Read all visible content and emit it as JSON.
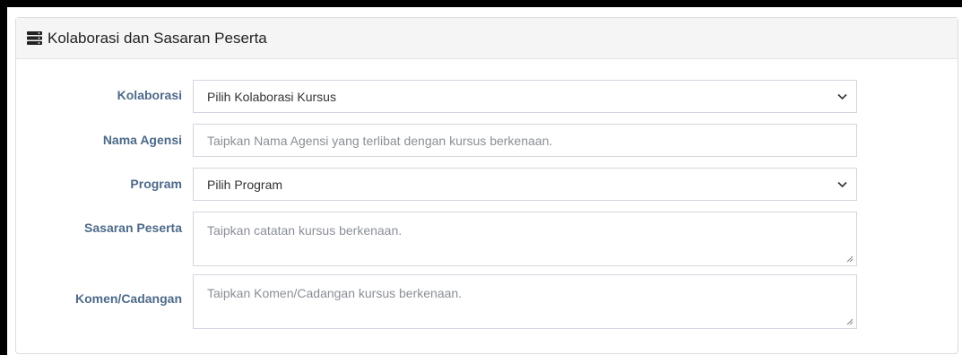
{
  "panel": {
    "title": "Kolaborasi dan Sasaran Peserta",
    "icon": "server-icon"
  },
  "form": {
    "kolaborasi": {
      "label": "Kolaborasi",
      "value": "Pilih Kolaborasi Kursus"
    },
    "nama_agensi": {
      "label": "Nama Agensi",
      "placeholder": "Taipkan Nama Agensi yang terlibat dengan kursus berkenaan."
    },
    "program": {
      "label": "Program",
      "value": "Pilih Program"
    },
    "sasaran_peserta": {
      "label": "Sasaran Peserta",
      "placeholder": "Taipkan catatan kursus berkenaan."
    },
    "komen_cadangan": {
      "label": "Komen/Cadangan",
      "placeholder": "Taipkan Komen/Cadangan kursus berkenaan."
    }
  },
  "colors": {
    "label": "#4d6a8a",
    "border": "#d2d6de",
    "heading_bg": "#f5f5f5"
  }
}
